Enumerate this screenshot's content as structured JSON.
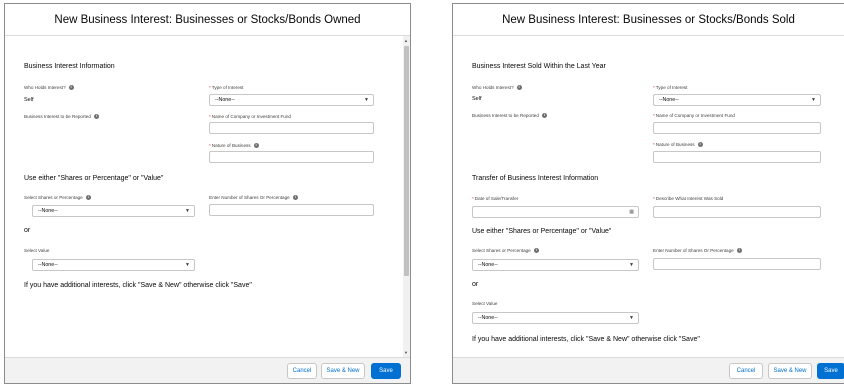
{
  "owned": {
    "title": "New Business Interest: Businesses or Stocks/Bonds Owned",
    "section_info": "Business Interest Information",
    "who_holds_label": "Who Holds Interest?",
    "who_holds_value": "Self",
    "type_label": "Type of Interest",
    "type_value": "--None--",
    "business_reported_label": "Business Interest to be Reported",
    "company_label": "Name of Company or Investment Fund",
    "nature_label": "Nature of Business",
    "use_either": "Use either \"Shares or Percentage\" or \"Value\"",
    "select_shares_label": "Select Shares or Percentage",
    "select_shares_value": "--None--",
    "enter_number_label": "Enter Number of Shares Or Percentage",
    "or_text": "or",
    "select_value_label": "Select Value",
    "select_value_value": "--None--",
    "additional_text": "If you have additional interests, click \"Save & New\" otherwise click \"Save\"",
    "cancel": "Cancel",
    "save_new": "Save & New",
    "save": "Save"
  },
  "sold": {
    "title": "New Business Interest: Businesses or Stocks/Bonds Sold",
    "section_info": "Business Interest Sold Within the Last Year",
    "who_holds_label": "Who Holds Interest?",
    "who_holds_value": "Self",
    "type_label": "Type of Interest",
    "type_value": "--None--",
    "business_reported_label": "Business Interest to be Reported",
    "company_label": "Name of Company or Investment Fund",
    "nature_label": "Nature of Business",
    "transfer_section": "Transfer of Business Interest Information",
    "date_label": "Date of Sale/Transfer",
    "describe_label": "Describe What Interest Was Sold",
    "use_either": "Use either \"Shares or Percentage\" or \"Value\"",
    "select_shares_label": "Select Shares or Percentage",
    "select_shares_value": "--None--",
    "enter_number_label": "Enter Number of Shares Or Percentage",
    "or_text": "or",
    "select_value_label": "Select Value",
    "select_value_value": "--None--",
    "additional_text": "If you have additional interests, click \"Save & New\" otherwise click \"Save\"",
    "cancel": "Cancel",
    "save_new": "Save & New",
    "save": "Save"
  },
  "icons": {
    "info": "info-icon",
    "chevron": "chevron-down-icon",
    "calendar": "calendar-icon"
  },
  "colors": {
    "brand": "#0070d2",
    "required": "#c23934"
  }
}
